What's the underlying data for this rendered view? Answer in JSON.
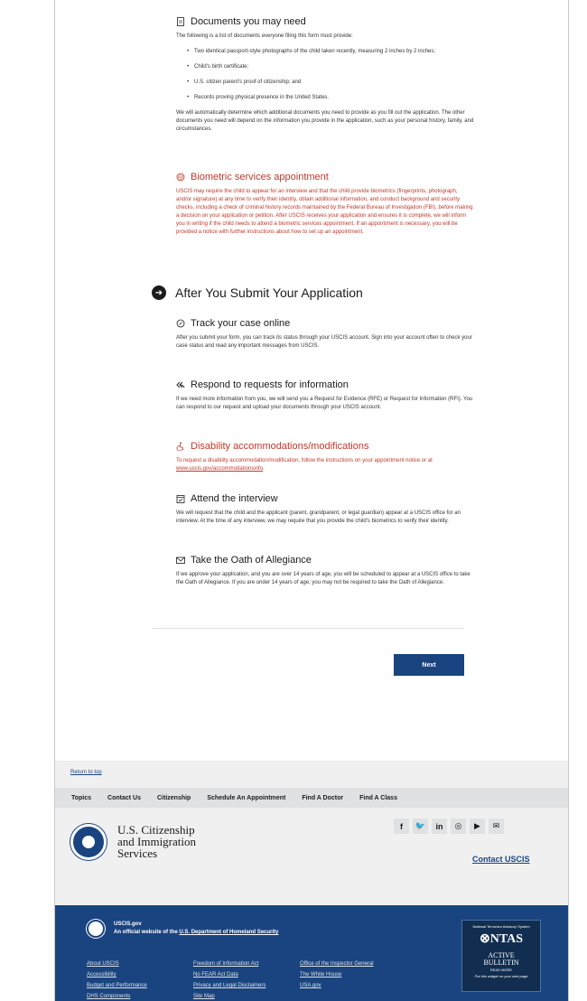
{
  "documents": {
    "title": "Documents you may need",
    "intro": "The following is a list of documents everyone filing this form must provide:",
    "items": [
      "Two identical passport-style photographs of the child taken recently, measuring 2 inches by 2 inches;",
      "Child's birth certificate;",
      "U.S. citizen parent's proof of citizenship; and",
      "Records proving physical presence in the United States."
    ],
    "outro": "We will automatically determine which additional documents you need to provide as you fill out the application. The other documents you need will depend on the information you provide in the application, such as your personal history, family, and circumstances."
  },
  "biometric": {
    "title": "Biometric services appointment",
    "body": "USCIS may require the child to appear for an interview and that the child provide biometrics (fingerprints, photograph, and/or signature) at any time to verify their identity, obtain additional information, and conduct background and security checks, including a check of criminal history records maintained by the Federal Bureau of Investigation (FBI), before making a decision on your application or petition. After USCIS receives your application and ensures it is complete, we will inform you in writing if the child needs to attend a biometric services appointment. If an appointment is necessary, you will be provided a notice with further instructions about how to set up an appointment."
  },
  "after": {
    "title": "After You Submit Your Application",
    "track": {
      "title": "Track your case online",
      "body": "After you submit your form, you can track its status through your USCIS account. Sign into your account often to check your case status and read any important messages from USCIS."
    },
    "respond": {
      "title": "Respond to requests for information",
      "body": "If we need more information from you, we will send you a Request for Evidence (RFE) or Request for Information (RFI). You can respond to our request and upload your documents through your USCIS account."
    },
    "disability": {
      "title": "Disability accommodations/modifications",
      "body": "To request a disability accommodation/modification, follow the instructions on your appointment notice or at",
      "link": "www.uscis.gov/accommodationsinfo"
    },
    "interview": {
      "title": "Attend the interview",
      "body": "We will request that the child and the applicant (parent, grandparent, or legal guardian) appear at a USCIS office for an interview. At the time of any interview, we may require that you provide the child's biometrics to verify their identity."
    },
    "oath": {
      "title": "Take the Oath of Allegiance",
      "body": "If we approve your application, and you are over 14 years of age, you will be scheduled to appear at a USCIS office to take the Oath of Allegiance. If you are under 14 years of age, you may not be required to take the Oath of Allegiance."
    }
  },
  "next_label": "Next",
  "footer": {
    "return_top": "Return to top",
    "nav": [
      "Topics",
      "Contact Us",
      "Citizenship",
      "Schedule An Appointment",
      "Find A Doctor",
      "Find A Class"
    ],
    "agency_lines": [
      "U.S. Citizenship",
      "and Immigration",
      "Services"
    ],
    "social_icons": [
      "facebook-icon",
      "twitter-icon",
      "linkedin-icon",
      "instagram-icon",
      "youtube-icon",
      "email-icon"
    ],
    "contact": "Contact USCIS",
    "site": "USCIS.gov",
    "official_prefix": "An official website of the",
    "official_link": "U.S. Department of Homeland Security",
    "links": [
      "About USCIS",
      "Freedom of Information Act",
      "Office of the Inspector General",
      "Accessibility",
      "No FEAR Act Data",
      "The White House",
      "Budget and Performance",
      "Privacy and Legal Disclaimers",
      "USA.gov",
      "DHS Components",
      "Site Map"
    ],
    "ntas": {
      "line1": "National Terrorism Advisory System",
      "logo": "NTAS",
      "active": "ACTIVE",
      "bulletin": "BULLETIN",
      "read_more": "READ MORE",
      "put": "Put this widget on your web page"
    }
  },
  "colors": {
    "accent": "#1a4480",
    "alert_red": "#c0392b"
  }
}
